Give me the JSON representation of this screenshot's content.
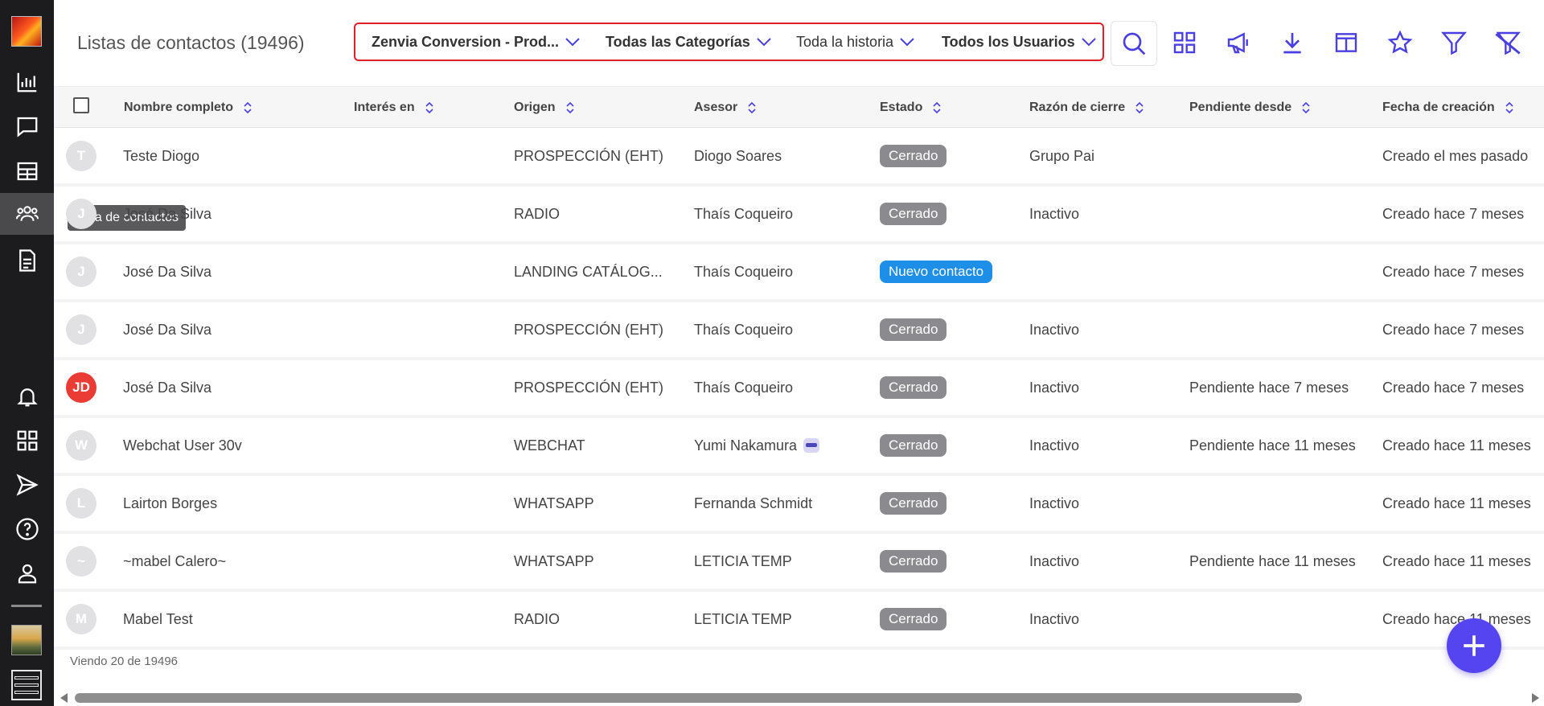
{
  "header": {
    "title": "Listas de contactos (19496)",
    "filters": [
      {
        "label": "Zenvia Conversion - Prod..."
      },
      {
        "label": "Todas las Categorías"
      },
      {
        "label": "Toda la historia"
      },
      {
        "label": "Todos los Usuarios"
      }
    ]
  },
  "sidebar": {
    "active": "contacts",
    "tooltip": "Lista de contactos",
    "items": [
      "dashboard-icon",
      "chat-icon",
      "table-icon",
      "contacts-icon",
      "document-icon",
      "bell-icon",
      "apps-icon",
      "send-icon",
      "help-icon",
      "user-icon"
    ]
  },
  "toolbar": {
    "icons": [
      "search-icon",
      "grid-icon",
      "megaphone-icon",
      "download-icon",
      "columns-icon",
      "star-icon",
      "filter-icon",
      "filter-off-icon"
    ]
  },
  "table": {
    "columns": [
      "Nombre completo",
      "Interés en",
      "Origen",
      "Asesor",
      "Estado",
      "Razón de cierre",
      "Pendiente desde",
      "Fecha de creación"
    ],
    "rows": [
      {
        "initial": "T",
        "name": "Teste Diogo",
        "interest": "",
        "origin": "PROSPECCIÓN (EHT)",
        "advisor": "Diogo Soares",
        "status": "Cerrado",
        "reason": "Grupo Pai",
        "pending": "",
        "created": "Creado el mes pasado"
      },
      {
        "initial": "J",
        "name": "José Da Silva",
        "interest": "",
        "origin": "RADIO",
        "advisor": "Thaís Coqueiro",
        "status": "Cerrado",
        "reason": "Inactivo",
        "pending": "",
        "created": "Creado hace 7 meses"
      },
      {
        "initial": "J",
        "name": "José Da Silva",
        "interest": "",
        "origin": "LANDING CATÁLOG...",
        "advisor": "Thaís Coqueiro",
        "status": "Nuevo contacto",
        "reason": "",
        "pending": "",
        "created": "Creado hace 7 meses"
      },
      {
        "initial": "J",
        "name": "José Da Silva",
        "interest": "",
        "origin": "PROSPECCIÓN (EHT)",
        "advisor": "Thaís Coqueiro",
        "status": "Cerrado",
        "reason": "Inactivo",
        "pending": "",
        "created": "Creado hace 7 meses"
      },
      {
        "initial": "JD",
        "name": "José Da Silva",
        "interest": "",
        "origin": "PROSPECCIÓN (EHT)",
        "advisor": "Thaís Coqueiro",
        "status": "Cerrado",
        "reason": "Inactivo",
        "pending": "Pendiente hace 7 meses",
        "created": "Creado hace 7 meses"
      },
      {
        "initial": "W",
        "name": "Webchat User 30v",
        "interest": "",
        "origin": "WEBCHAT",
        "advisor": "Yumi Nakamura",
        "status": "Cerrado",
        "reason": "Inactivo",
        "pending": "Pendiente hace 11 meses",
        "created": "Creado hace 11 meses"
      },
      {
        "initial": "L",
        "name": "Lairton Borges",
        "interest": "",
        "origin": "WHATSAPP",
        "advisor": "Fernanda Schmidt",
        "status": "Cerrado",
        "reason": "Inactivo",
        "pending": "",
        "created": "Creado hace 11 meses"
      },
      {
        "initial": "~",
        "name": "~mabel Calero~",
        "interest": "",
        "origin": "WHATSAPP",
        "advisor": "LETICIA TEMP",
        "status": "Cerrado",
        "reason": "Inactivo",
        "pending": "Pendiente hace 11 meses",
        "created": "Creado hace 11 meses"
      },
      {
        "initial": "M",
        "name": "Mabel Test",
        "interest": "",
        "origin": "RADIO",
        "advisor": "LETICIA TEMP",
        "status": "Cerrado",
        "reason": "Inactivo",
        "pending": "",
        "created": "Creado hace 11 meses"
      }
    ]
  },
  "footer": {
    "viewing": "Viendo 20 de 19496",
    "scroll_fraction": 0.845
  },
  "colors": {
    "sidebar_bg": "#1c1c1e",
    "accent": "#5545f0",
    "icon": "#4a3fe0",
    "status_closed": "#8a8a8f",
    "status_new": "#1e8fe8",
    "filter_border": "#e0202a",
    "avatar_red": "#ea3b35"
  }
}
